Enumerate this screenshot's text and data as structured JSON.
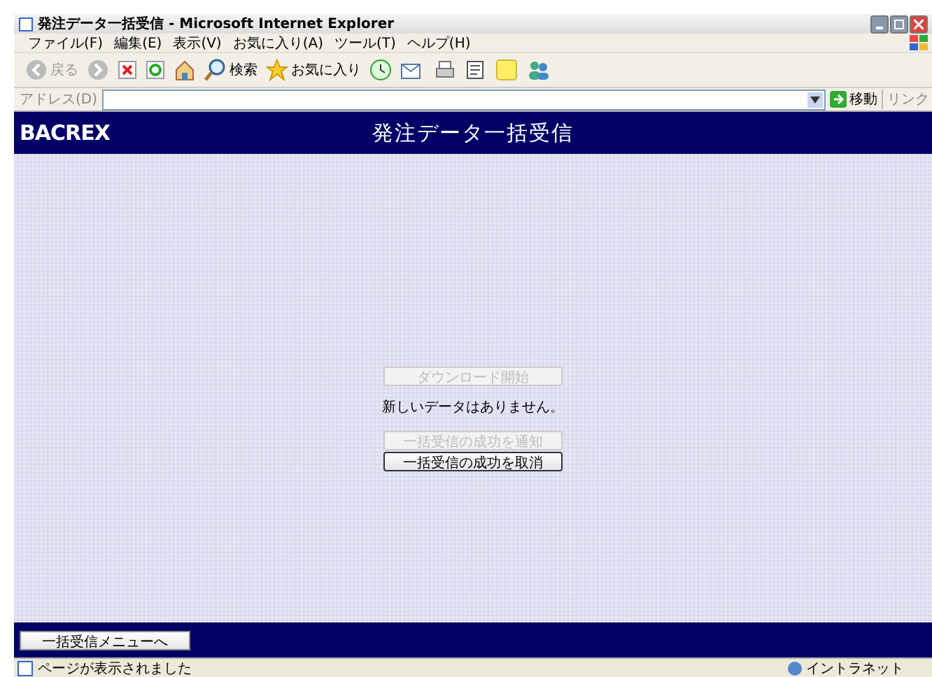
{
  "window": {
    "title": "発注データ一括受信 - Microsoft Internet Explorer"
  },
  "menu": [
    "ファイル(F)",
    "編集(E)",
    "表示(V)",
    "お気に入り(A)",
    "ツール(T)",
    "ヘルプ(H)"
  ],
  "toolbar": {
    "back": "戻る",
    "search": "検索",
    "favorites": "お気に入り"
  },
  "address": {
    "label": "アドレス(D)",
    "go": "移動",
    "links": "リンク"
  },
  "header": {
    "logo": "BACREX",
    "title": "発注データ一括受信"
  },
  "content": {
    "buttons": [
      {
        "label": "ダウンロード開始",
        "disabled": true
      }
    ],
    "message": "新しいデータはありません。",
    "actions": [
      {
        "label": "一括受信の成功を通知",
        "disabled": true
      },
      {
        "label": "一括受信の成功を取消",
        "disabled": false
      }
    ]
  },
  "footer": {
    "button": "一括受信メニューへ"
  },
  "status": {
    "text": "ページが表示されました",
    "zone": "イントラネット"
  }
}
